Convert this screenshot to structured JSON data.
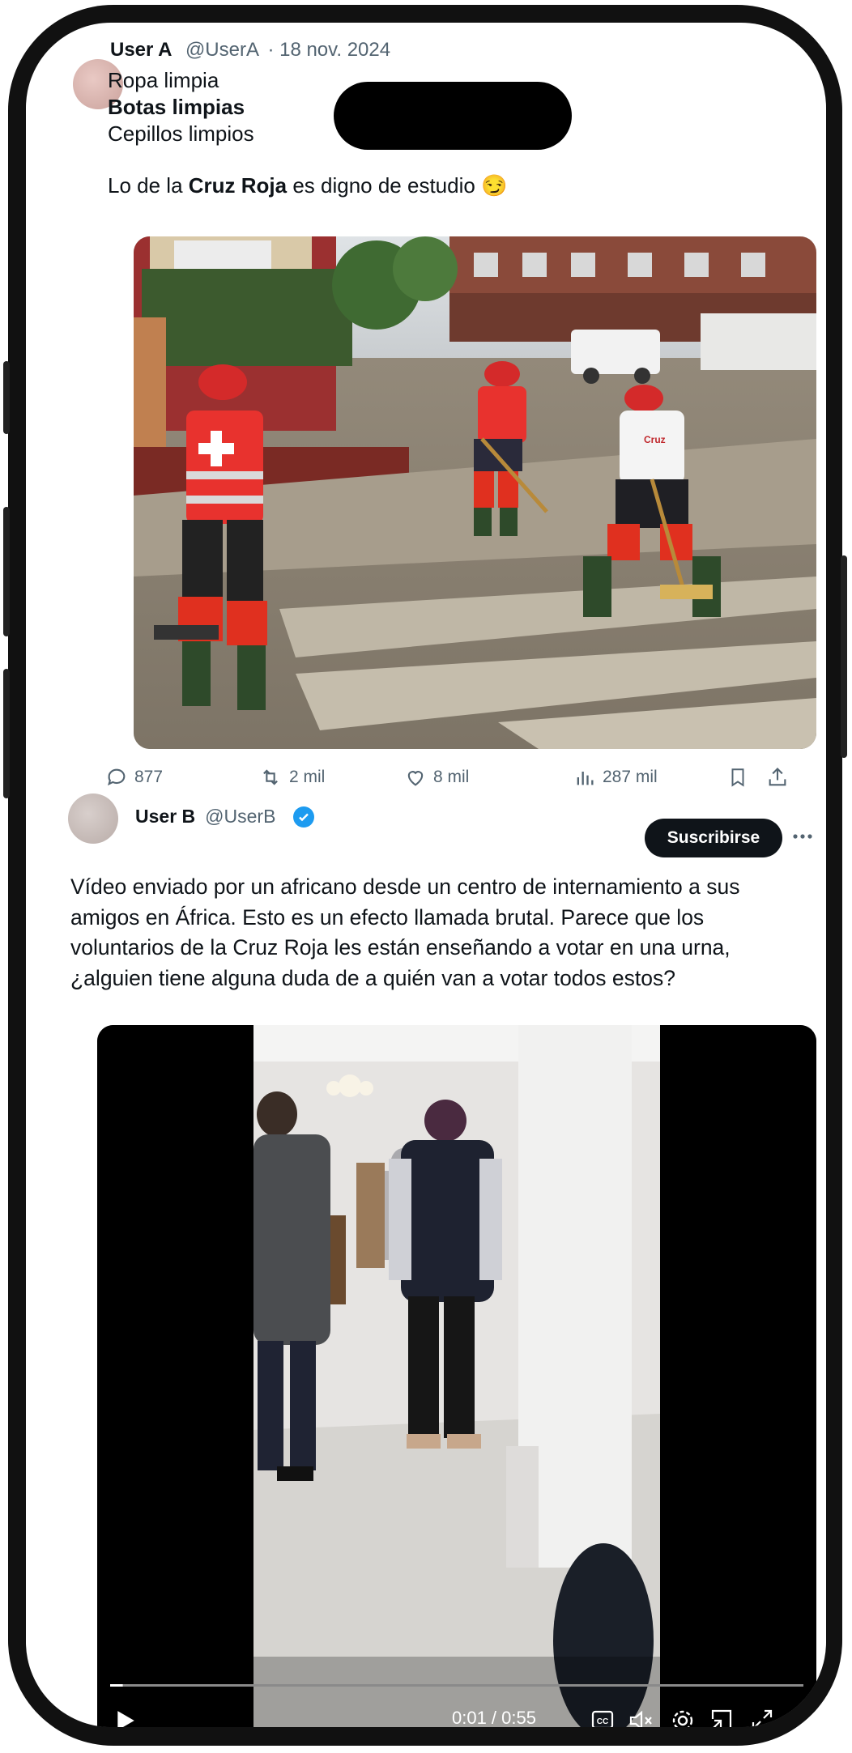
{
  "post_a": {
    "user_name": "User A",
    "user_handle": "@UserA",
    "date": "· 18 nov. 2024",
    "lines": [
      "Ropa limpia",
      "Botas limpias",
      "Cepillos limpios"
    ],
    "text_prefix": "Lo de la ",
    "text_bold": "Cruz Roja",
    "text_suffix": " es digno de estudio 😏",
    "image_vest_text": "Cruz",
    "stats": {
      "replies": "877",
      "reposts": "2 mil",
      "likes": "8 mil",
      "views": "287 mil"
    }
  },
  "post_b": {
    "user_name": "User B",
    "user_handle": "@UserB",
    "subscribe_label": "Suscribirse",
    "text_lines": [
      "Vídeo enviado por un africano desde un centro de internamiento a sus",
      "amigos en África. Esto es un efecto llamada brutal. Parece que los",
      "voluntarios de la Cruz Roja les están enseñando a votar en una urna,",
      "¿alguien tiene alguna duda de a quién van a votar todos estos?"
    ],
    "video": {
      "time": "0:01 / 0:55",
      "progress": 0.0182
    }
  },
  "icons": [
    "reply-icon",
    "repost-icon",
    "like-icon",
    "views-icon",
    "bookmark-icon",
    "share-icon",
    "verified-icon",
    "more-icon",
    "play-icon",
    "captions-icon",
    "mute-icon",
    "settings-icon",
    "pip-icon",
    "fullscreen-icon"
  ]
}
